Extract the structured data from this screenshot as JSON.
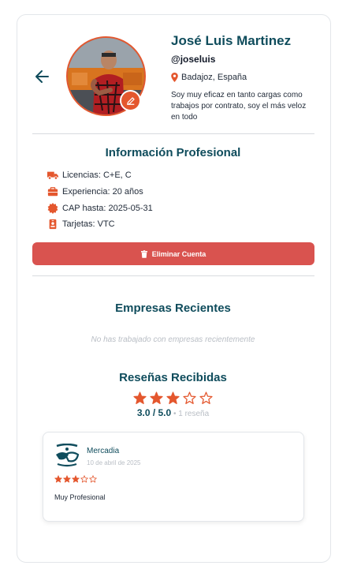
{
  "profile": {
    "name": "José Luis Martinez",
    "handle": "@joseluis",
    "location": "Badajoz, España",
    "bio": "Soy muy eficaz en tanto cargas como trabajos por contrato, soy el más veloz en todo"
  },
  "professional": {
    "title": "Información Profesional",
    "licenses": "Licencias: C+E, C",
    "experience": "Experiencia: 20 años",
    "cap": "CAP hasta: 2025-05-31",
    "cards": "Tarjetas: VTC"
  },
  "actions": {
    "delete_label": "Eliminar Cuenta"
  },
  "companies": {
    "title": "Empresas Recientes",
    "empty_message": "No has trabajado con empresas recientemente"
  },
  "reviews": {
    "title": "Reseñas Recibidas",
    "average_rating": 3,
    "rating_text": "3.0 / 5.0",
    "count_text": " • 1 reseña",
    "items": [
      {
        "company": "Mercadia",
        "date": "10 de abril de 2025",
        "rating": 3,
        "text": "Muy Profesional"
      }
    ]
  },
  "colors": {
    "accent": "#e4572e",
    "title": "#0f4c5c",
    "danger": "#d9534f",
    "muted": "#b9bec5"
  },
  "icons": {
    "back": "arrow-left-icon",
    "edit": "pencil-icon",
    "location": "map-pin-icon",
    "licenses": "truck-icon",
    "experience": "briefcase-icon",
    "cap": "certificate-icon",
    "cards": "id-card-icon",
    "delete": "trash-icon",
    "star": "star-icon"
  }
}
